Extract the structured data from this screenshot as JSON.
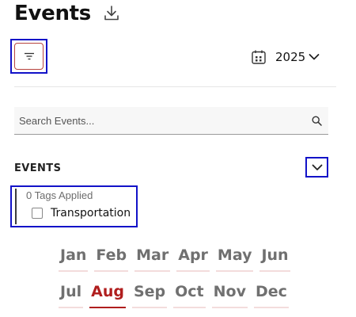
{
  "header": {
    "title": "Events",
    "download_icon": "download-icon"
  },
  "toolbar": {
    "filter_icon": "filter-icon",
    "year_icon": "calendar-icon",
    "year": "2025"
  },
  "search": {
    "placeholder": "Search Events...",
    "value": "",
    "icon": "search-icon"
  },
  "events_section": {
    "title": "EVENTS",
    "toggle_icon": "chevron-down-icon",
    "tags_applied": "0 Tags Applied",
    "tags": [
      {
        "label": "Transportation",
        "checked": false
      }
    ]
  },
  "months": {
    "row1": [
      "Jan",
      "Feb",
      "Mar",
      "Apr",
      "May",
      "Jun"
    ],
    "row2": [
      "Jul",
      "Aug",
      "Sep",
      "Oct",
      "Nov",
      "Dec"
    ],
    "selected": "Aug"
  },
  "colors": {
    "accent": "#b01e1e",
    "focus_outline": "#1212c8",
    "month_inactive": "#707070"
  }
}
